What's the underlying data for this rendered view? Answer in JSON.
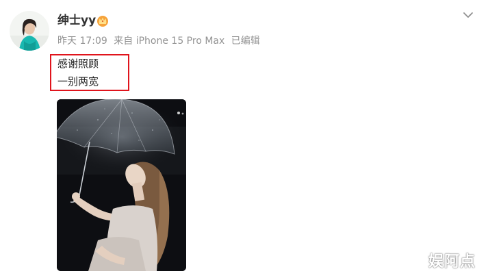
{
  "post": {
    "username": "绅士yy",
    "meta": {
      "time": "昨天 17:09",
      "source": "来自 iPhone 15 Pro Max",
      "edited": "已编辑"
    },
    "content_lines": [
      "感谢照顾",
      "一别两宽"
    ],
    "icons": {
      "badge": "vip-crown-icon",
      "menu": "chevron-down-icon"
    },
    "colors": {
      "highlight_border": "#e0141c",
      "meta_text": "#939393"
    }
  },
  "watermark": {
    "text": "娱阿点"
  }
}
